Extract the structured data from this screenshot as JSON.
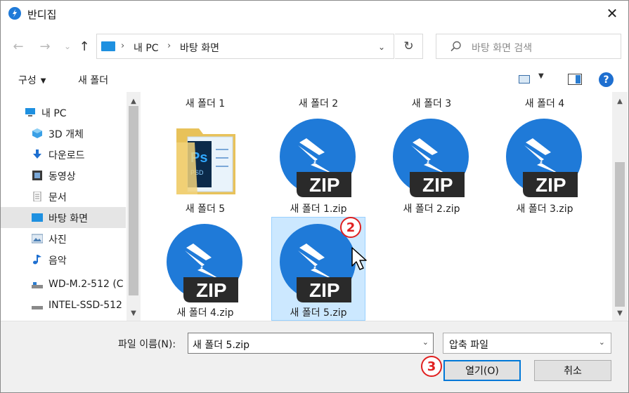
{
  "window": {
    "title": "반디집",
    "close_glyph": "✕"
  },
  "nav": {
    "back_glyph": "←",
    "forward_glyph": "→",
    "recent_glyph": "⌄",
    "up_glyph": "↑",
    "breadcrumb": [
      "내 PC",
      "바탕 화면"
    ],
    "breadcrumb_sep": "›",
    "address_dropdown_glyph": "⌄",
    "refresh_glyph": "↻",
    "search_placeholder": "바탕 화면 검색"
  },
  "toolbar": {
    "organize_label": "구성",
    "organize_arrow": "▼",
    "new_folder_label": "새 폴더",
    "view_dropdown_glyph": "▼",
    "help_glyph": "?"
  },
  "sidebar": {
    "items": [
      {
        "label": "내 PC",
        "icon": "pc-icon"
      },
      {
        "label": "3D 개체",
        "icon": "3d-objects-icon"
      },
      {
        "label": "다운로드",
        "icon": "download-icon"
      },
      {
        "label": "동영상",
        "icon": "video-icon"
      },
      {
        "label": "문서",
        "icon": "document-icon"
      },
      {
        "label": "바탕 화면",
        "icon": "desktop-icon",
        "selected": true
      },
      {
        "label": "사진",
        "icon": "picture-icon"
      },
      {
        "label": "음악",
        "icon": "music-icon"
      },
      {
        "label": "WD-M.2-512 (C",
        "icon": "drive-icon"
      },
      {
        "label": "INTEL-SSD-512",
        "icon": "drive-icon"
      }
    ],
    "scroll_up_glyph": "▲",
    "scroll_down_glyph": "▼"
  },
  "content": {
    "top_row_labels": [
      "새 폴더 1",
      "새 폴더 2",
      "새 폴더 3",
      "새 폴더 4"
    ],
    "tiles": [
      {
        "label": "새 폴더 5",
        "type": "folder"
      },
      {
        "label": "새 폴더 1.zip",
        "type": "zip"
      },
      {
        "label": "새 폴더 2.zip",
        "type": "zip"
      },
      {
        "label": "새 폴더 3.zip",
        "type": "zip"
      },
      {
        "label": "새 폴더 4.zip",
        "type": "zip"
      },
      {
        "label": "새 폴더 5.zip",
        "type": "zip",
        "selected": true
      }
    ],
    "zip_text": "ZIP",
    "folder_thumb_text": "Ps",
    "folder_thumb_subtext": "PSD"
  },
  "bottom": {
    "filename_label": "파일 이름(N):",
    "filename_value": "새 폴더 5.zip",
    "filename_dropdown_glyph": "⌄",
    "filetype_value": "압축 파일",
    "filetype_dropdown_glyph": "⌄",
    "open_label": "열기(O)",
    "cancel_label": "취소"
  },
  "annotations": {
    "step2": "2",
    "step3": "3"
  },
  "colors": {
    "accent": "#0078d7",
    "zip_blue": "#1f7ad8",
    "badge_red": "#e02020",
    "selection": "#cce8ff"
  }
}
